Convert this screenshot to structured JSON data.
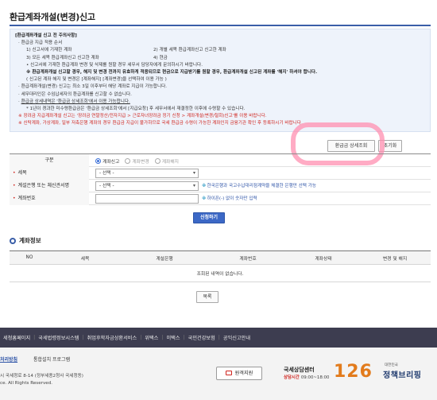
{
  "page": {
    "title": "환급계좌개설(변경)신고"
  },
  "notice": {
    "title": "[환급계좌개설 신고 전 주의사항]",
    "scope_title": "환급금 지급 적용 순서",
    "scope_items_row1": [
      "1) 신고서에 기재한 계좌",
      "2) 개별 세목 환급계좌신고 신고한 계좌"
    ],
    "scope_items_row2": [
      "3) 모든 세목 환급계좌신고 신고한 계좌",
      "4) 현금"
    ],
    "lines": [
      "신고서에 기재한 환급계좌 변경 및 삭제를 원할 경우 세무서 담당자에게 문의하시기 바랍니다.",
      "※ 환급계좌개설 신고할 경우, 해지 및 변경 전까지 유효하게 적용되므로 현금으로 지급받기를 원할 경우, 환급계좌개설 신고된 계좌를 '해지' 하셔야 합니다.",
      "( 신고된 계좌 해지 및 변경은 [계좌해지] [계좌변경]을 선택하여 이용 가능 )",
      "환급계좌개설(변경) 신고는 최소 3일 이후부터 해당 계좌로 지급이 가능합니다.",
      "세무대리인은 수임납세자의 환급계좌를 신고할 수 없습니다.",
      "환급금 상세내역은 '환급금 상세조회'에서 이용 가능합니다.",
      "* 1년이 경과한 미수령환급금은 '환급금 상세조회'에서 [지급요청] 후 세무서에서 재결정한 이후에 수령할 수 있습니다.",
      "※ 장려금 지급계좌개설 신고는 '장려금 연말정산/전자지급 > 근로자녀장려금 정기 신청 > 계좌개설(변경/철회)신고'를 이용 바랍니다.",
      "※ 신탁계좌, 가상계좌, 일부 저축은행 계좌의 경우 환급금 지급이 불가하므로 국세 환급금 수령이 가능한 계좌인지 금융기관 확인 후 등록하시기 바랍니다."
    ]
  },
  "buttons": {
    "refund_detail": "환급금 상세조회",
    "reset": "초기화",
    "apply": "신청하기",
    "list": "목록"
  },
  "form": {
    "type_label": "구분",
    "type_options": [
      "계좌신고",
      "계좌변경",
      "계좌해지"
    ],
    "tax_label": "세목",
    "tax_select": "- 선택 -",
    "bank_label": "계설은행 또는 체신관서명",
    "bank_select": "- 선택 -",
    "bank_hint": "한국은행과 국고수납대리점계약을 체결한 은행만 선택 가능",
    "account_label": "계좌번호",
    "account_value": "",
    "account_hint": "하이픈(-) 없이 숫자만 입력"
  },
  "section": {
    "title": "계좌정보"
  },
  "table": {
    "headers": [
      "NO",
      "세목",
      "계설은행",
      "계좌번호",
      "계좌상태",
      "변경 및 해지"
    ],
    "empty_message": "조회된 내역이 없습니다."
  },
  "footer_nav": [
    "세청홈페이지",
    "국세법령정보시스템",
    "취업후학자금상환서비스",
    "위택스",
    "이택스",
    "국민건강보험",
    "공익신고안내"
  ],
  "footer": {
    "policy": "처리방침",
    "install": "통합설치 프로그램",
    "address": "시 국세청로 8-14 (정부세종2청사 국세청동)",
    "copyright": "ce. All Rights Reserved.",
    "remote": "원격지원",
    "center_name": "국세상담센터",
    "hours_label": "상담시간",
    "hours_value": "09:00~18:00",
    "center_number": "126",
    "brand_small": "대한민국",
    "brand": "정책브리핑"
  },
  "colors": {
    "accent": "#3a5ea8",
    "warning": "#d0251f",
    "highlight": "#ff8fb0"
  }
}
